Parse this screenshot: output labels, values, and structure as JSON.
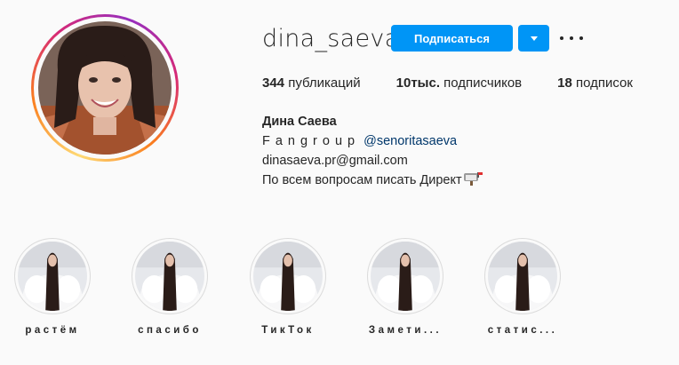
{
  "profile": {
    "username": "dina_saeva",
    "follow_label": "Подписаться",
    "more_icon": "more-horizontal-icon",
    "stats": {
      "posts_count": "344",
      "posts_label": "публикаций",
      "followers_count": "10тыс.",
      "followers_label": "подписчиков",
      "following_count": "18",
      "following_label": "подписок"
    },
    "bio": {
      "full_name": "Дина Саева",
      "line1_text": "Fangroup",
      "line1_mention": "@senoritasaeva",
      "email": "dinasaeva.pr@gmail.com",
      "line3": "По всем вопросам писать Директ"
    }
  },
  "highlights": [
    {
      "label": "растём"
    },
    {
      "label": "спасибо"
    },
    {
      "label": "ТикТок"
    },
    {
      "label": "Замети..."
    },
    {
      "label": "статис..."
    }
  ],
  "colors": {
    "accent": "#0095f6",
    "text": "#262626",
    "mention": "#00376b",
    "background": "#fafafa"
  }
}
